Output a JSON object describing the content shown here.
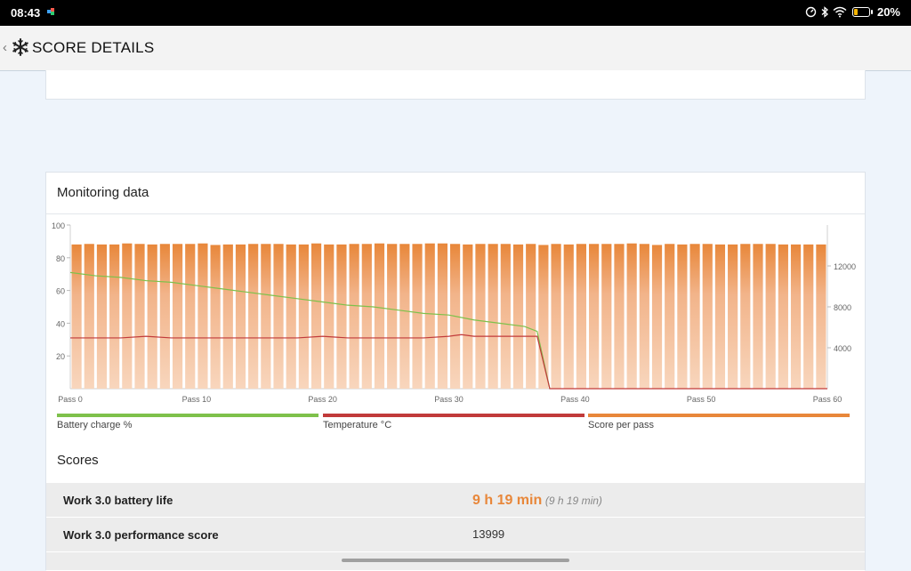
{
  "status_bar": {
    "time": "08:43",
    "battery_percent": "20%",
    "icons": [
      "speed-indicator-icon",
      "bluetooth-icon",
      "wifi-icon",
      "battery-icon"
    ]
  },
  "app_bar": {
    "title": "SCORE DETAILS",
    "back_icon": "chevron-left-icon",
    "logo_icon": "snowflake-logo-icon"
  },
  "monitoring": {
    "title": "Monitoring data"
  },
  "chart_data": {
    "type": "bar",
    "x_tick_labels": [
      "Pass 0",
      "Pass 10",
      "Pass 20",
      "Pass 30",
      "Pass 40",
      "Pass 50",
      "Pass 60"
    ],
    "x_ticks": [
      0,
      10,
      20,
      30,
      40,
      50,
      60
    ],
    "xlim": [
      0,
      60
    ],
    "left_axis": {
      "ylim": [
        0,
        100
      ],
      "ticks": [
        20,
        40,
        60,
        80,
        100
      ]
    },
    "right_axis": {
      "ylim": [
        0,
        16000
      ],
      "ticks": [
        4000,
        8000,
        12000
      ]
    },
    "grid": false,
    "legend_position": "bottom",
    "series": [
      {
        "name": "Score per pass",
        "color": "#e8873a",
        "axis": "right",
        "kind": "bar",
        "values": [
          14100,
          14150,
          14100,
          14100,
          14200,
          14150,
          14100,
          14150,
          14150,
          14150,
          14200,
          14050,
          14100,
          14100,
          14150,
          14150,
          14150,
          14100,
          14100,
          14200,
          14100,
          14100,
          14150,
          14150,
          14200,
          14150,
          14150,
          14150,
          14200,
          14200,
          14150,
          14100,
          14150,
          14150,
          14150,
          14100,
          14150,
          14050,
          14150,
          14100,
          14150,
          14150,
          14150,
          14150,
          14200,
          14150,
          14050,
          14150,
          14100,
          14150,
          14150,
          14100,
          14100,
          14150,
          14150,
          14150,
          14100,
          14100,
          14100,
          14100
        ]
      },
      {
        "name": "Battery charge %",
        "color": "#7ec14b",
        "axis": "left",
        "kind": "line",
        "x": [
          0,
          2,
          4,
          6,
          8,
          10,
          12,
          14,
          16,
          18,
          20,
          22,
          24,
          26,
          28,
          30,
          32,
          34,
          36,
          37,
          38
        ],
        "values": [
          71,
          69,
          68,
          66,
          65,
          63,
          61,
          59,
          57,
          55,
          53,
          51,
          50,
          48,
          46,
          45,
          42,
          40,
          38,
          35,
          0
        ]
      },
      {
        "name": "Temperature °C",
        "color": "#c13a3a",
        "axis": "left",
        "kind": "line",
        "x": [
          0,
          2,
          4,
          6,
          8,
          10,
          12,
          14,
          16,
          18,
          20,
          22,
          24,
          26,
          28,
          30,
          31,
          32,
          34,
          36,
          37,
          38,
          60
        ],
        "values": [
          31,
          31,
          31,
          32,
          31,
          31,
          31,
          31,
          31,
          31,
          32,
          31,
          31,
          31,
          31,
          32,
          33,
          32,
          32,
          32,
          32,
          0,
          0
        ]
      }
    ]
  },
  "legend": [
    {
      "label": "Battery charge %",
      "color": "#7ec14b"
    },
    {
      "label": "Temperature °C",
      "color": "#c13a3a"
    },
    {
      "label": "Score per pass",
      "color": "#e8873a"
    }
  ],
  "scores": {
    "title": "Scores",
    "rows": [
      {
        "label": "Work 3.0 battery life",
        "value": "9 h 19 min",
        "sub": "(9 h 19 min)"
      },
      {
        "label": "Work 3.0 performance score",
        "value": "13999"
      }
    ]
  }
}
